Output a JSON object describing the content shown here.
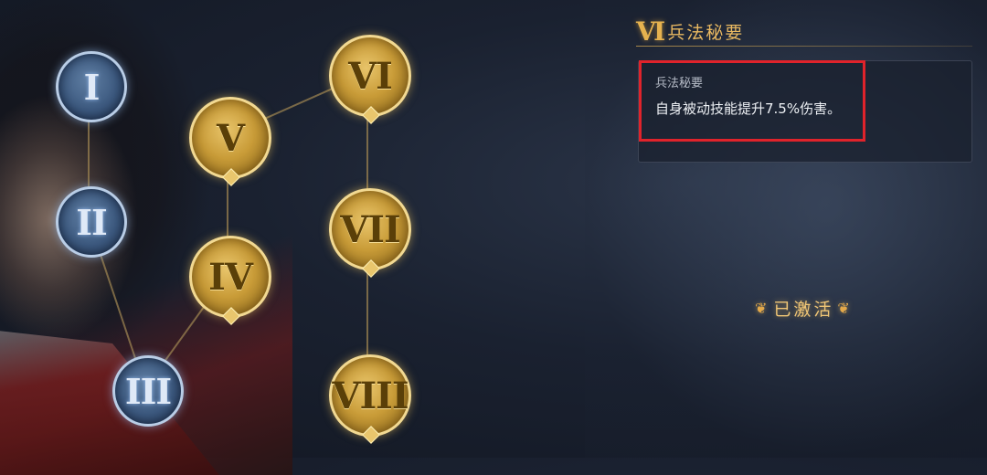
{
  "skill_tree": {
    "nodes": [
      {
        "id": "I",
        "numeral": "I",
        "state": "silver"
      },
      {
        "id": "II",
        "numeral": "II",
        "state": "silver"
      },
      {
        "id": "III",
        "numeral": "III",
        "state": "silver"
      },
      {
        "id": "IV",
        "numeral": "IV",
        "state": "gold"
      },
      {
        "id": "V",
        "numeral": "V",
        "state": "gold"
      },
      {
        "id": "VI",
        "numeral": "VI",
        "state": "gold"
      },
      {
        "id": "VII",
        "numeral": "VII",
        "state": "gold"
      },
      {
        "id": "VIII",
        "numeral": "VIII",
        "state": "gold"
      }
    ]
  },
  "detail": {
    "roman": "Ⅵ",
    "title": "兵法秘要",
    "subtitle": "兵法秘要",
    "description": "自身被动技能提升7.5%伤害。",
    "status": "已激活"
  },
  "colors": {
    "gold": "#e6b24f",
    "highlight": "#e0232b",
    "silver_border": "#b9cde6"
  }
}
